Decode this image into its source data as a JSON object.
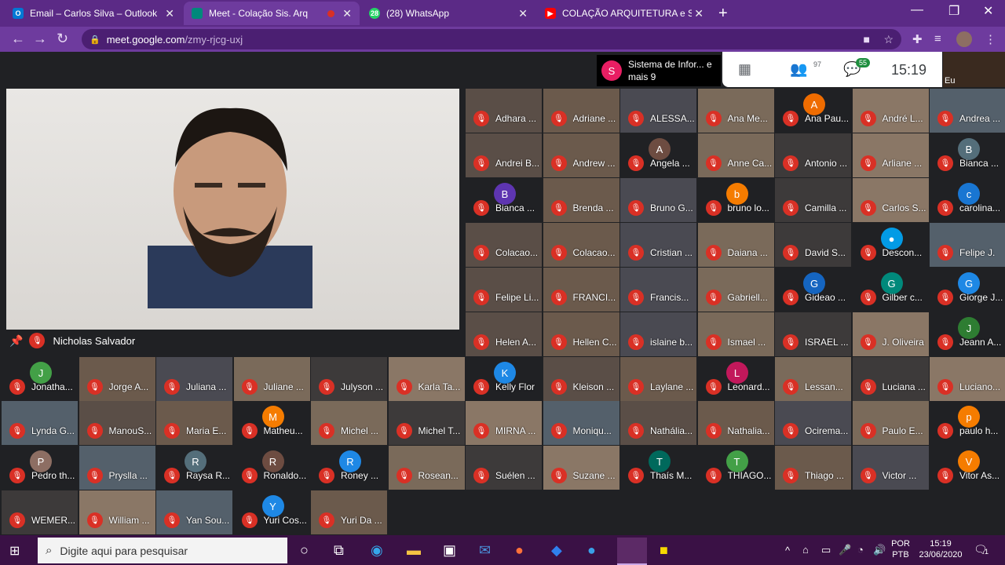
{
  "tabs": [
    {
      "title": "Email – Carlos Silva – Outlook",
      "favicon": "outlook-icon",
      "fav_label": "O",
      "color": "#0078d4"
    },
    {
      "title": "Meet - Colação Sis. Arq",
      "favicon": "meet-icon",
      "fav_label": "",
      "color": "#00897b"
    },
    {
      "title": "(28) WhatsApp",
      "favicon": "whatsapp-icon",
      "fav_label": "28",
      "color": "#25d366"
    },
    {
      "title": "COLAÇÃO ARQUITETURA e SISTE",
      "favicon": "youtube-icon",
      "fav_label": "▶",
      "color": "#ff0000"
    }
  ],
  "address": {
    "host": "meet.google.com",
    "path": "/zmy-rjcg-uxj"
  },
  "meet": {
    "presenter_label": "Sistema de Infor... e mais 9",
    "presenter_avatar": "S",
    "people_count": "97",
    "chat_count": "55",
    "time": "15:19",
    "self_label": "Eu",
    "main_speaker": "Nicholas Salvador"
  },
  "participants": [
    {
      "name": "Adhara ...",
      "type": "vid"
    },
    {
      "name": "Adriane ...",
      "type": "vid"
    },
    {
      "name": "ALESSA...",
      "type": "vid"
    },
    {
      "name": "Ana Me...",
      "type": "vid"
    },
    {
      "name": "Ana Pau...",
      "type": "av",
      "letter": "A",
      "color": "#ef6c00"
    },
    {
      "name": "André L...",
      "type": "vid"
    },
    {
      "name": "Andrea ...",
      "type": "vid"
    },
    {
      "name": "Andrei B...",
      "type": "vid"
    },
    {
      "name": "Andrew ...",
      "type": "vid"
    },
    {
      "name": "Angela ...",
      "type": "av",
      "letter": "A",
      "color": "#6d4c41"
    },
    {
      "name": "Anne Ca...",
      "type": "vid"
    },
    {
      "name": "Antonio ...",
      "type": "vid"
    },
    {
      "name": "Arliane ...",
      "type": "vid"
    },
    {
      "name": "Bianca ...",
      "type": "av",
      "letter": "B",
      "color": "#546e7a"
    },
    {
      "name": "Bianca ...",
      "type": "av",
      "letter": "B",
      "color": "#5e35b1"
    },
    {
      "name": "Brenda ...",
      "type": "vid"
    },
    {
      "name": "Bruno G...",
      "type": "vid"
    },
    {
      "name": "bruno lo...",
      "type": "av",
      "letter": "b",
      "color": "#f57c00"
    },
    {
      "name": "Camilla ...",
      "type": "vid"
    },
    {
      "name": "Carlos S...",
      "type": "vid"
    },
    {
      "name": "carolina...",
      "type": "av",
      "letter": "c",
      "color": "#1976d2"
    },
    {
      "name": "Colacao...",
      "type": "vid"
    },
    {
      "name": "Colacao...",
      "type": "vid"
    },
    {
      "name": "Cristian ...",
      "type": "vid"
    },
    {
      "name": "Daiana ...",
      "type": "vid"
    },
    {
      "name": "David S...",
      "type": "vid"
    },
    {
      "name": "Descon...",
      "type": "av",
      "letter": "●",
      "color": "#039be5"
    },
    {
      "name": "Felipe J.",
      "type": "vid"
    },
    {
      "name": "Felipe Li...",
      "type": "vid"
    },
    {
      "name": "FRANCI...",
      "type": "vid"
    },
    {
      "name": "Francis...",
      "type": "vid"
    },
    {
      "name": "Gabriell...",
      "type": "vid"
    },
    {
      "name": "Gideao ...",
      "type": "av",
      "letter": "G",
      "color": "#1565c0"
    },
    {
      "name": "Gilber c...",
      "type": "av",
      "letter": "G",
      "color": "#00897b"
    },
    {
      "name": "Giorge J...",
      "type": "av",
      "letter": "G",
      "color": "#1e88e5"
    },
    {
      "name": "Helen A...",
      "type": "vid"
    },
    {
      "name": "Hellen C...",
      "type": "vid"
    },
    {
      "name": "islaine b...",
      "type": "vid"
    },
    {
      "name": "Ismael ...",
      "type": "vid"
    },
    {
      "name": "ISRAEL ...",
      "type": "vid"
    },
    {
      "name": "J. Oliveira",
      "type": "vid"
    },
    {
      "name": "Jeann A...",
      "type": "av",
      "letter": "J",
      "color": "#2e7d32"
    },
    {
      "name": "Jonatha...",
      "type": "av",
      "letter": "J",
      "color": "#43a047"
    },
    {
      "name": "Jorge A...",
      "type": "vid"
    },
    {
      "name": "Juliana ...",
      "type": "vid"
    },
    {
      "name": "Juliane ...",
      "type": "vid"
    },
    {
      "name": "Julyson ...",
      "type": "vid"
    },
    {
      "name": "Karla Ta...",
      "type": "vid"
    },
    {
      "name": "Kelly Flor",
      "type": "av",
      "letter": "K",
      "color": "#1e88e5"
    },
    {
      "name": "Kleison ...",
      "type": "vid"
    },
    {
      "name": "Laylane ...",
      "type": "vid"
    },
    {
      "name": "Leonard...",
      "type": "av",
      "letter": "L",
      "color": "#c2185b"
    },
    {
      "name": "Lessan...",
      "type": "vid"
    },
    {
      "name": "Luciana ...",
      "type": "vid"
    },
    {
      "name": "Luciano...",
      "type": "vid"
    },
    {
      "name": "Lynda G...",
      "type": "vid"
    },
    {
      "name": "ManouS...",
      "type": "vid"
    },
    {
      "name": "Maria E...",
      "type": "vid"
    },
    {
      "name": "Matheu...",
      "type": "av",
      "letter": "M",
      "color": "#f57c00"
    },
    {
      "name": "Michel ...",
      "type": "vid"
    },
    {
      "name": "Michel T...",
      "type": "vid"
    },
    {
      "name": "MIRNA ...",
      "type": "vid"
    },
    {
      "name": "Moniqu...",
      "type": "vid"
    },
    {
      "name": "Nathália...",
      "type": "vid"
    },
    {
      "name": "Nathalia...",
      "type": "vid"
    },
    {
      "name": "Ocirema...",
      "type": "vid"
    },
    {
      "name": "Paulo E...",
      "type": "vid"
    },
    {
      "name": "paulo h...",
      "type": "av",
      "letter": "p",
      "color": "#f57c00"
    },
    {
      "name": "Pedro th...",
      "type": "av",
      "letter": "P",
      "color": "#8d6e63"
    },
    {
      "name": "Pryslla ...",
      "type": "vid"
    },
    {
      "name": "Raysa R...",
      "type": "av",
      "letter": "R",
      "color": "#546e7a"
    },
    {
      "name": "Ronaldo...",
      "type": "av",
      "letter": "R",
      "color": "#6d4c41"
    },
    {
      "name": "Roney ...",
      "type": "av",
      "letter": "R",
      "color": "#1e88e5"
    },
    {
      "name": "Rosean...",
      "type": "vid"
    },
    {
      "name": "Suélen ...",
      "type": "vid"
    },
    {
      "name": "Suzane ...",
      "type": "vid"
    },
    {
      "name": "Thaís M...",
      "type": "av",
      "letter": "T",
      "color": "#00695c"
    },
    {
      "name": "THIAGO...",
      "type": "av",
      "letter": "T",
      "color": "#43a047"
    },
    {
      "name": "Thiago ...",
      "type": "vid"
    },
    {
      "name": "Victor ...",
      "type": "vid"
    },
    {
      "name": "Vitor As...",
      "type": "av",
      "letter": "V",
      "color": "#f57c00"
    },
    {
      "name": "WEMER...",
      "type": "vid"
    },
    {
      "name": "William ...",
      "type": "vid"
    },
    {
      "name": "Yan Sou...",
      "type": "vid"
    },
    {
      "name": "Yuri Cos...",
      "type": "av",
      "letter": "Y",
      "color": "#1e88e5"
    },
    {
      "name": "Yuri Da ...",
      "type": "vid"
    }
  ],
  "taskbar": {
    "search_placeholder": "Digite aqui para pesquisar",
    "lang": "POR",
    "layout": "PTB",
    "clock": "15:19",
    "date": "23/06/2020",
    "notif_count": "1"
  }
}
